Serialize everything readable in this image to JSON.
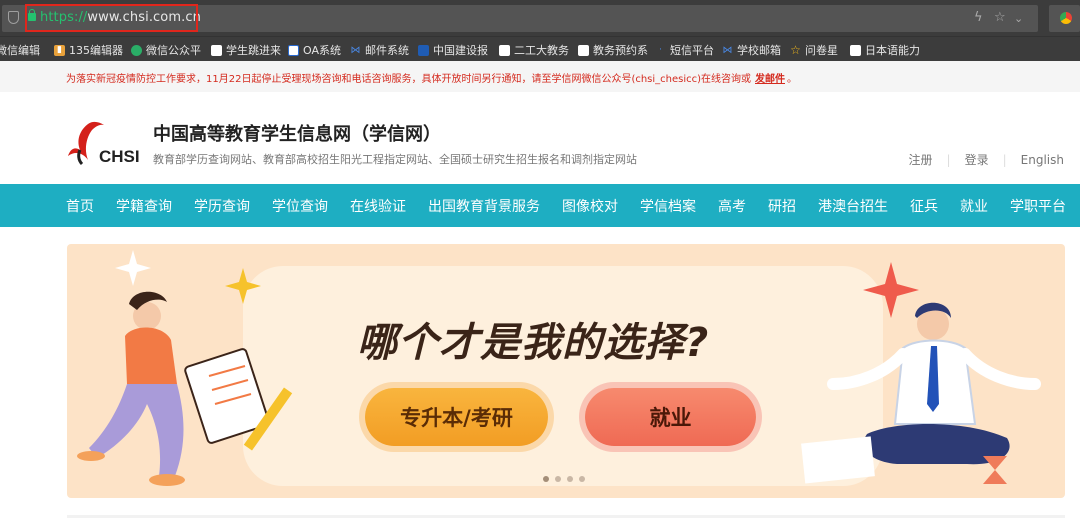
{
  "browser": {
    "url_scheme": "https://",
    "url_rest": "www.chsi.com.cn",
    "bookmarks": [
      "微信编辑",
      "135编辑器",
      "微信公众平",
      "学生跳进来",
      "OA系统",
      "邮件系统",
      "中国建设报",
      "二工大教务",
      "教务预约系",
      "短信平台",
      "学校邮箱",
      "问卷星",
      "日本语能力"
    ]
  },
  "notice": {
    "text": "为落实新冠疫情防控工作要求，11月22日起停止受理现场咨询和电话咨询服务，具体开放时间另行通知，请至学信网微信公众号(chsi_chesicc)在线咨询或",
    "link": "发邮件",
    "end": "。"
  },
  "header": {
    "logo_text": "CHSI",
    "title": "中国高等教育学生信息网（学信网）",
    "subtitle": "教育部学历查询网站、教育部高校招生阳光工程指定网站、全国硕士研究生招生报名和调剂指定网站",
    "register": "注册",
    "login": "登录",
    "english": "English"
  },
  "nav": [
    "首页",
    "学籍查询",
    "学历查询",
    "学位查询",
    "在线验证",
    "出国教育背景服务",
    "图像校对",
    "学信档案",
    "高考",
    "研招",
    "港澳台招生",
    "征兵",
    "就业",
    "学职平台"
  ],
  "banner": {
    "headline": "哪个才是我的选择?",
    "button_left": "专升本/考研",
    "button_right": "就业",
    "slides": 4,
    "active_slide": 1
  },
  "colors": {
    "nav_bg": "#1eaec2",
    "notice_text": "#d42a1e",
    "banner_bg": "#fde3c7"
  }
}
